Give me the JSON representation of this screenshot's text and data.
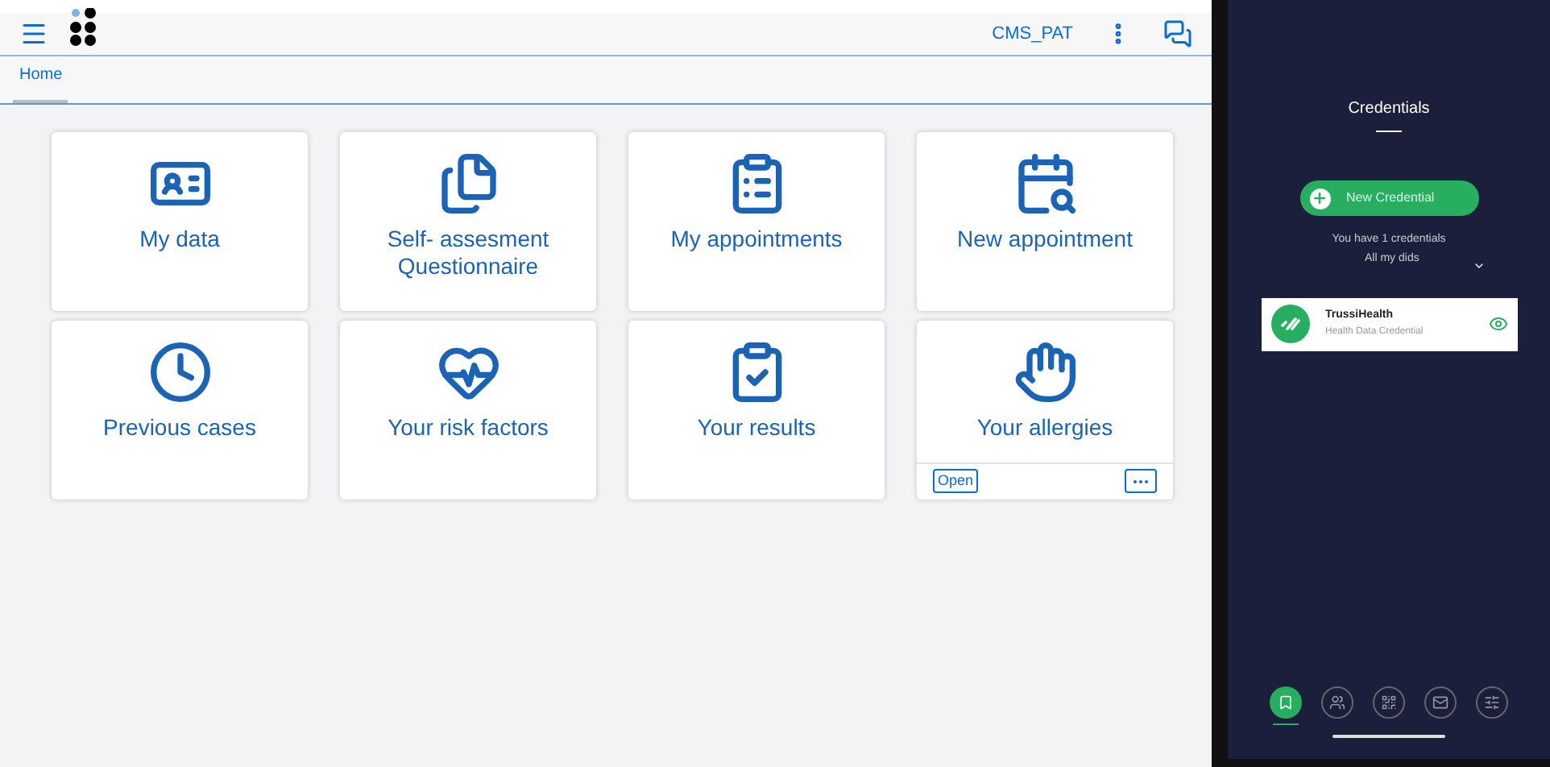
{
  "shell": {
    "user": "CMS_PAT"
  },
  "tabs": [
    {
      "label": "Home",
      "selected": true
    }
  ],
  "tiles": [
    {
      "title": "My data"
    },
    {
      "title": "Self- assesment Questionnaire"
    },
    {
      "title": "My appointments"
    },
    {
      "title": "New appointment"
    },
    {
      "title": "Previous cases"
    },
    {
      "title": "Your risk factors"
    },
    {
      "title": "Your results"
    },
    {
      "title": "Your allergies",
      "footer": {
        "open": "Open"
      }
    }
  ],
  "wallet": {
    "title": "Credentials",
    "new_button": "New Credential",
    "count_text": "You have 1 credentials",
    "filter": "All my dids",
    "credentials": [
      {
        "name": "TrussiHealth",
        "type": "Health Data Credential"
      }
    ],
    "nav": [
      {
        "selected": true
      },
      {
        "selected": false
      },
      {
        "selected": false
      },
      {
        "selected": false
      },
      {
        "selected": false
      }
    ]
  }
}
